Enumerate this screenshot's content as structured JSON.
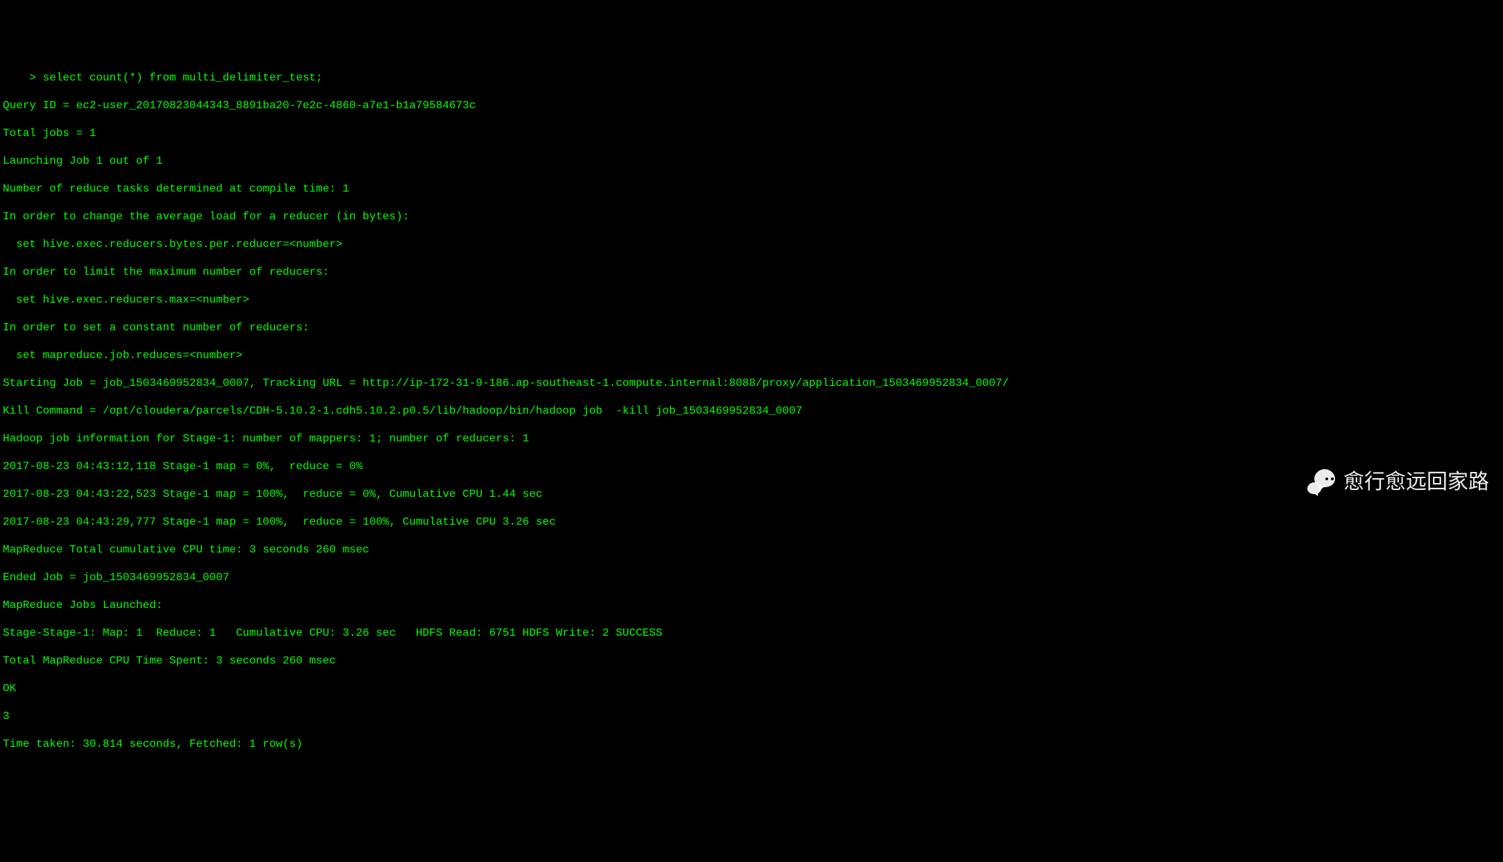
{
  "terminal": {
    "lines": [
      "    > select count(*) from multi_delimiter_test;",
      "Query ID = ec2-user_20170823044343_8891ba20-7e2c-4860-a7e1-b1a79584673c",
      "Total jobs = 1",
      "Launching Job 1 out of 1",
      "Number of reduce tasks determined at compile time: 1",
      "In order to change the average load for a reducer (in bytes):",
      "  set hive.exec.reducers.bytes.per.reducer=<number>",
      "In order to limit the maximum number of reducers:",
      "  set hive.exec.reducers.max=<number>",
      "In order to set a constant number of reducers:",
      "  set mapreduce.job.reduces=<number>",
      "Starting Job = job_1503469952834_0007, Tracking URL = http://ip-172-31-9-186.ap-southeast-1.compute.internal:8088/proxy/application_1503469952834_0007/",
      "Kill Command = /opt/cloudera/parcels/CDH-5.10.2-1.cdh5.10.2.p0.5/lib/hadoop/bin/hadoop job  -kill job_1503469952834_0007",
      "Hadoop job information for Stage-1: number of mappers: 1; number of reducers: 1",
      "2017-08-23 04:43:12,118 Stage-1 map = 0%,  reduce = 0%",
      "2017-08-23 04:43:22,523 Stage-1 map = 100%,  reduce = 0%, Cumulative CPU 1.44 sec",
      "2017-08-23 04:43:29,777 Stage-1 map = 100%,  reduce = 100%, Cumulative CPU 3.26 sec",
      "MapReduce Total cumulative CPU time: 3 seconds 260 msec",
      "Ended Job = job_1503469952834_0007",
      "MapReduce Jobs Launched: ",
      "Stage-Stage-1: Map: 1  Reduce: 1   Cumulative CPU: 3.26 sec   HDFS Read: 6751 HDFS Write: 2 SUCCESS",
      "Total MapReduce CPU Time Spent: 3 seconds 260 msec",
      "OK",
      "3",
      "Time taken: 30.814 seconds, Fetched: 1 row(s)"
    ]
  },
  "watermark": {
    "text": "愈行愈远回家路"
  }
}
